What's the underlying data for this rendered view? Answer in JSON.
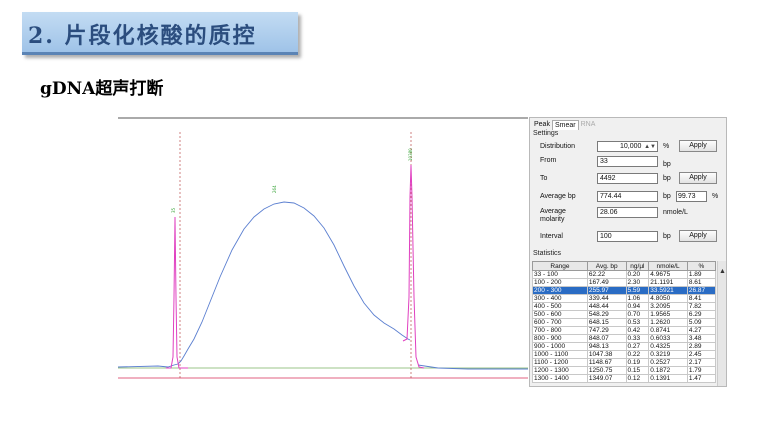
{
  "slide": {
    "title": "2. 片段化核酸的质控",
    "subtitle": "gDNA超声打断"
  },
  "panel": {
    "tabs": [
      "Peak",
      "Smear",
      "RNA"
    ],
    "active_tab": "Smear",
    "settings_label": "Settings",
    "distribution": {
      "label": "Distribution",
      "value": "10,000",
      "unit": "%",
      "button": "Apply"
    },
    "from": {
      "label": "From",
      "value": "33",
      "unit": "bp"
    },
    "to": {
      "label": "To",
      "value": "4492",
      "unit": "bp",
      "button": "Apply"
    },
    "average_bp": {
      "label": "Average bp",
      "value": "774.44",
      "unit": "bp",
      "pct_value": "99.73",
      "pct_unit": "%"
    },
    "average_molarity": {
      "label_line1": "Average",
      "label_line2": "molarity",
      "value": "28.06",
      "unit": "nmole/L"
    },
    "interval": {
      "label": "Interval",
      "value": "100",
      "unit": "bp",
      "button": "Apply"
    },
    "statistics_label": "Statistics",
    "stats_headers": [
      "Range",
      "Avg. bp",
      "ng/µl",
      "nmole/L",
      "%"
    ],
    "stats_rows": [
      [
        "33 - 100",
        "62.22",
        "0.20",
        "4.9675",
        "1.89"
      ],
      [
        "100 - 200",
        "167.49",
        "2.30",
        "21.1191",
        "8.61"
      ],
      [
        "200 - 300",
        "255.97",
        "5.59",
        "33.5921",
        "26.87"
      ],
      [
        "300 - 400",
        "339.44",
        "1.06",
        "4.8050",
        "8.41"
      ],
      [
        "400 - 500",
        "448.44",
        "0.94",
        "3.2095",
        "7.82"
      ],
      [
        "500 - 600",
        "548.29",
        "0.70",
        "1.9565",
        "6.29"
      ],
      [
        "600 - 700",
        "648.15",
        "0.53",
        "1.2620",
        "5.09"
      ],
      [
        "700 - 800",
        "747.29",
        "0.42",
        "0.8741",
        "4.27"
      ],
      [
        "800 - 900",
        "848.07",
        "0.33",
        "0.6033",
        "3.48"
      ],
      [
        "900 - 1000",
        "948.13",
        "0.27",
        "0.4325",
        "2.89"
      ],
      [
        "1000 - 1100",
        "1047.38",
        "0.22",
        "0.3219",
        "2.45"
      ],
      [
        "1100 - 1200",
        "1148.67",
        "0.19",
        "0.2527",
        "2.17"
      ],
      [
        "1200 - 1300",
        "1250.75",
        "0.15",
        "0.1872",
        "1.79"
      ],
      [
        "1300 - 1400",
        "1349.07",
        "0.12",
        "0.1391",
        "1.47"
      ]
    ],
    "selected_row": 2
  },
  "colors": {
    "trace": "#5b7fd0",
    "marker": "#e040c0",
    "baseline": "#7ab060",
    "selection": "#2a6cc4"
  }
}
